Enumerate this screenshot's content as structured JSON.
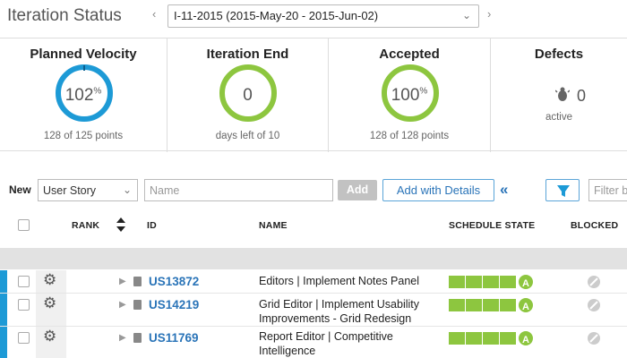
{
  "header": {
    "title": "Iteration Status",
    "prev_arrow": "‹",
    "next_arrow": "›",
    "iteration_value": "I-11-2015 (2015-May-20 - 2015-Jun-02)",
    "dropdown_chevron": "⌄"
  },
  "panels": {
    "planned_velocity": {
      "title": "Planned Velocity",
      "value": "102",
      "unit": "%",
      "sub": "128 of 125 points",
      "ring_color": "#1d9ad6",
      "fraction": 1.02
    },
    "iteration_end": {
      "title": "Iteration End",
      "value": "0",
      "sub": "days left of 10",
      "ring_color": "#8dc63f",
      "fraction": 1.0
    },
    "accepted": {
      "title": "Accepted",
      "value": "100",
      "unit": "%",
      "sub": "128 of 128 points",
      "ring_color": "#8dc63f",
      "fraction": 1.0
    },
    "defects": {
      "title": "Defects",
      "value": "0",
      "sub": "active",
      "icon": "bug-icon"
    }
  },
  "toolbar": {
    "new_label": "New",
    "type_value": "User Story",
    "name_placeholder": "Name",
    "add_label": "Add",
    "add_details_label": "Add with Details",
    "collapse_label": "«",
    "filter_placeholder": "Filter b",
    "filter_icon": "filter-icon"
  },
  "grid": {
    "columns": {
      "rank": "RANK",
      "id": "ID",
      "name": "NAME",
      "schedule_state": "SCHEDULE STATE",
      "blocked": "BLOCKED"
    },
    "rows": [
      {
        "id": "US13872",
        "name": "Editors | Implement Notes Panel",
        "state_badge": "A",
        "state_segments": 4
      },
      {
        "id": "US14219",
        "name": "Grid Editor | Implement Usability Improvements - Grid Redesign",
        "state_badge": "A",
        "state_segments": 4
      },
      {
        "id": "US11769",
        "name": "Report Editor | Competitive Intelligence",
        "state_badge": "A",
        "state_segments": 4
      }
    ]
  },
  "colors": {
    "accent_blue": "#1d9ad6",
    "accepted_green": "#8dc63f",
    "link_blue": "#2a74b8"
  }
}
